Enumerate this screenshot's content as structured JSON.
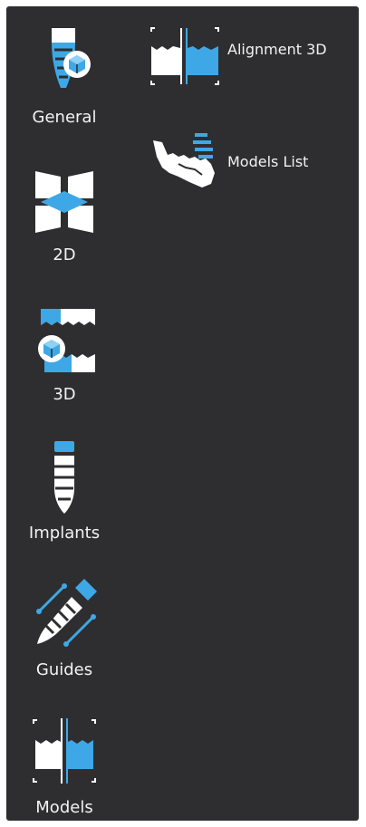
{
  "colors": {
    "background": "#2e2e30",
    "icon_white": "#ffffff",
    "icon_accent": "#3ea8e6",
    "text": "#f2f2f2"
  },
  "sidebar": {
    "items": [
      {
        "label": "General",
        "icon": "implant-3d-cube-icon"
      },
      {
        "label": "2D",
        "icon": "panoramic-slices-icon"
      },
      {
        "label": "3D",
        "icon": "jaw-3d-cube-icon"
      },
      {
        "label": "Implants",
        "icon": "implant-icon"
      },
      {
        "label": "Guides",
        "icon": "surgical-guide-icon"
      },
      {
        "label": "Models",
        "icon": "models-align-icon"
      }
    ]
  },
  "tools": {
    "items": [
      {
        "label": "Alignment 3D",
        "icon": "alignment-3d-icon"
      },
      {
        "label": "Models List",
        "icon": "models-list-icon"
      }
    ]
  }
}
